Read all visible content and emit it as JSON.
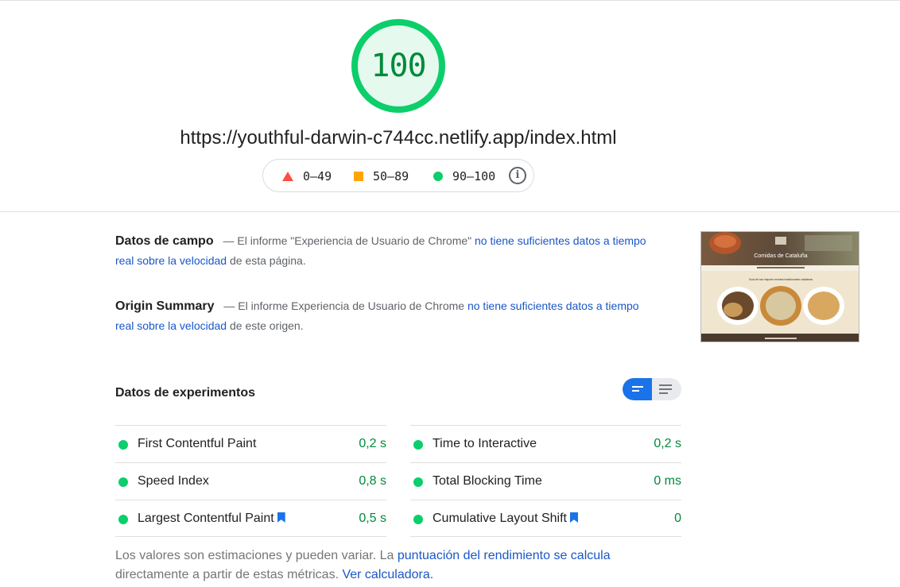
{
  "score": {
    "value": "100",
    "color": "#0cce6b",
    "fill": "#e6f9ef",
    "text_color": "#008a3b",
    "fraction": 1.0
  },
  "page_url": "https://youthful-darwin-c744cc.netlify.app/index.html",
  "legend": {
    "fail": "0–49",
    "average": "50–89",
    "pass": "90–100",
    "info_icon": "info-icon"
  },
  "field_data": {
    "title": "Datos de campo",
    "prefix": "— El informe \"Experiencia de Usuario de Chrome\"",
    "link": "no tiene suficientes datos a tiempo real sobre la velocidad",
    "suffix": "de esta página."
  },
  "origin_summary": {
    "title": "Origin Summary",
    "prefix": "— El informe Experiencia de Usuario de Chrome",
    "link": "no tiene suficientes datos a tiempo real sobre la velocidad",
    "suffix": "de este origen."
  },
  "screenshot": {
    "heading": "Comidas de Cataluña",
    "subheading": "Guía de las mejores recetas tradicionales catalanas"
  },
  "lab_data": {
    "title": "Datos de experimentos",
    "view_toggle": [
      "compact-view-icon",
      "list-view-icon"
    ],
    "metrics_left": [
      {
        "name": "First Contentful Paint",
        "value": "0,2 s",
        "bookmark": false
      },
      {
        "name": "Speed Index",
        "value": "0,8 s",
        "bookmark": false
      },
      {
        "name": "Largest Contentful Paint",
        "value": "0,5 s",
        "bookmark": true
      }
    ],
    "metrics_right": [
      {
        "name": "Time to Interactive",
        "value": "0,2 s",
        "bookmark": false
      },
      {
        "name": "Total Blocking Time",
        "value": "0 ms",
        "bookmark": false
      },
      {
        "name": "Cumulative Layout Shift",
        "value": "0",
        "bookmark": true
      }
    ]
  },
  "footer": {
    "text1": "Los valores son estimaciones y pueden variar. La",
    "link1": "puntuación del rendimiento se calcula",
    "text2": "directamente a partir de estas métricas.",
    "link2": "Ver calculadora."
  },
  "colors": {
    "pass": "#0cce6b",
    "average": "#ffa400",
    "fail": "#ff4e42",
    "link": "#1a57c8",
    "toggle_active": "#1a73e8"
  }
}
